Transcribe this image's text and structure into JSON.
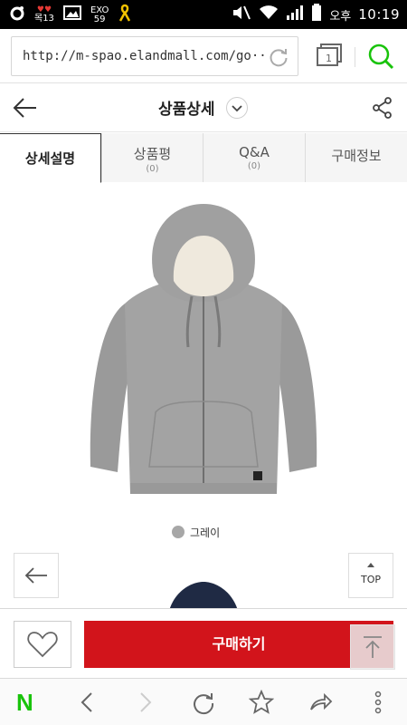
{
  "status_bar": {
    "carrier_badge": "목13",
    "notif_count": "59",
    "ampm": "오후",
    "time": "10:19"
  },
  "browser": {
    "url": "http://m-spao.elandmall.com/go···"
  },
  "header": {
    "title": "상품상세"
  },
  "tabs": [
    {
      "label": "상세설명",
      "count": ""
    },
    {
      "label": "상품평",
      "count": "(0)"
    },
    {
      "label": "Q&A",
      "count": "(0)"
    },
    {
      "label": "구매정보",
      "count": ""
    }
  ],
  "product": {
    "color_name": "그레이",
    "color_hex": "#a7a7a7"
  },
  "buttons": {
    "top_label": "TOP",
    "buy_label": "구매하기"
  },
  "colors": {
    "accent": "#d2141b",
    "naver_green": "#19c30b"
  }
}
